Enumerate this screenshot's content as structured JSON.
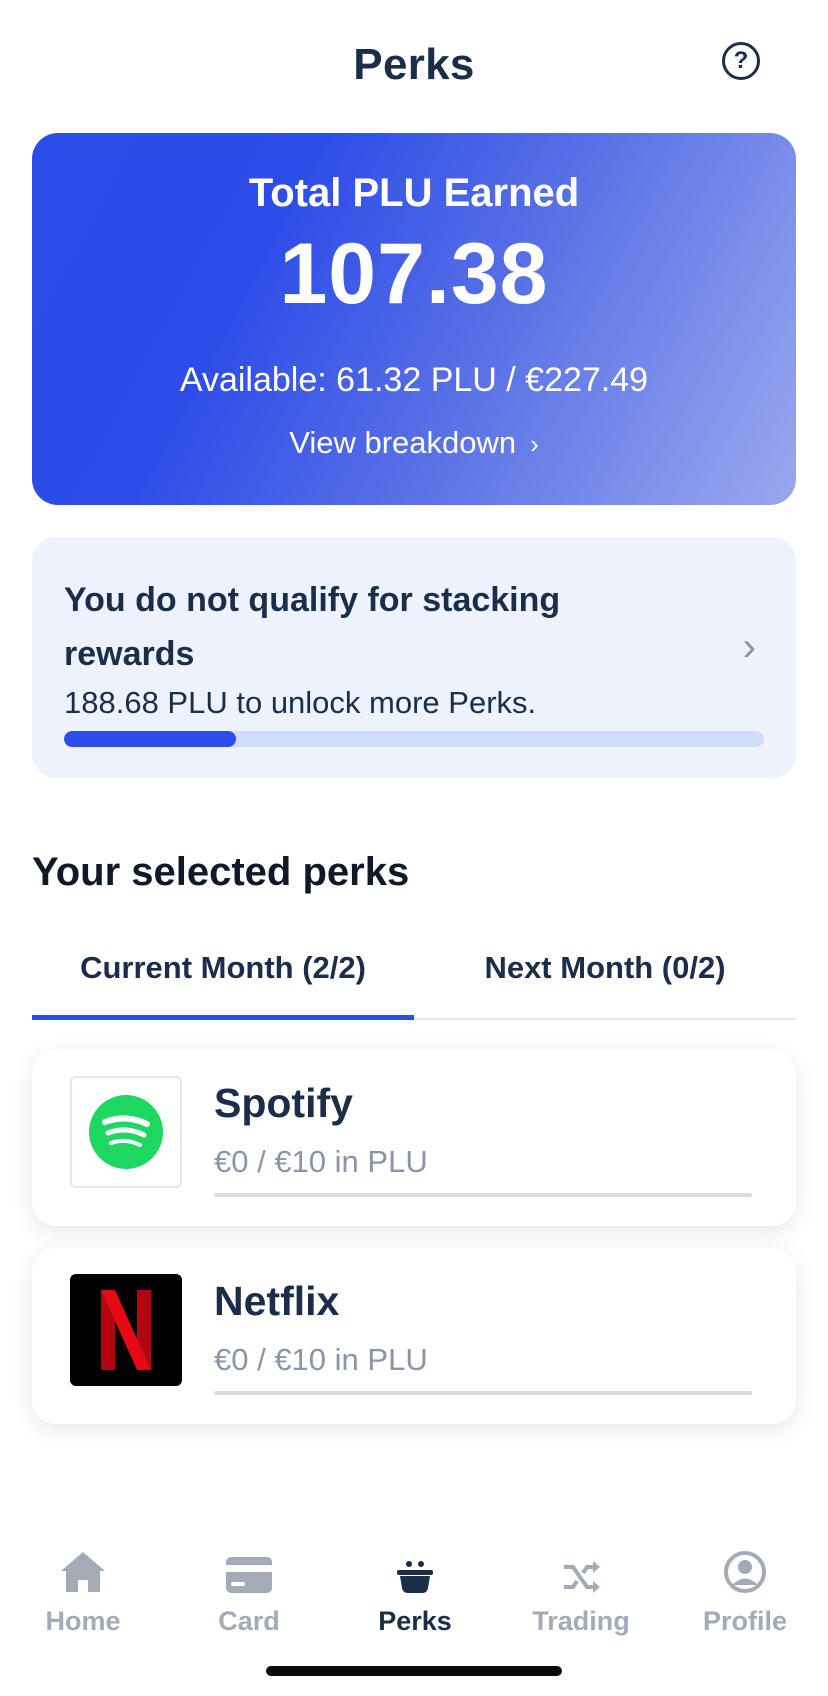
{
  "header": {
    "title": "Perks",
    "help_icon": "question-circle-icon"
  },
  "total_card": {
    "label": "Total PLU Earned",
    "value": "107.38",
    "available": "Available: 61.32 PLU / €227.49",
    "breakdown_link": "View breakdown",
    "breakdown_icon": "chevron-right-icon"
  },
  "stacking": {
    "title": "You do not qualify for stacking rewards",
    "subtitle": "188.68 PLU to unlock more Perks.",
    "progress_fraction": 0.245,
    "chevron_icon": "chevron-right-icon"
  },
  "selected_perks": {
    "title": "Your selected perks",
    "tabs": [
      {
        "label": "Current Month (2/2)",
        "active": true
      },
      {
        "label": "Next Month (0/2)",
        "active": false
      }
    ],
    "items": [
      {
        "name": "Spotify",
        "amount": "€0 / €10 in PLU",
        "progress_fraction": 0,
        "logo": "spotify-logo"
      },
      {
        "name": "Netflix",
        "amount": "€0 / €10 in PLU",
        "progress_fraction": 0,
        "logo": "netflix-logo"
      }
    ]
  },
  "bottom_nav": {
    "items": [
      {
        "label": "Home",
        "icon": "home-icon",
        "active": false
      },
      {
        "label": "Card",
        "icon": "card-icon",
        "active": false
      },
      {
        "label": "Perks",
        "icon": "perks-pot-icon",
        "active": true
      },
      {
        "label": "Trading",
        "icon": "shuffle-icon",
        "active": false
      },
      {
        "label": "Profile",
        "icon": "profile-icon",
        "active": false
      }
    ]
  },
  "colors": {
    "accent": "#2b4de8",
    "text_dark": "#1c2d4a",
    "muted": "#8b94a8",
    "nav_inactive": "#a4abb7",
    "stacking_bg": "#edf2fd",
    "spotify_green": "#1ed760",
    "netflix_red": "#e50914"
  }
}
